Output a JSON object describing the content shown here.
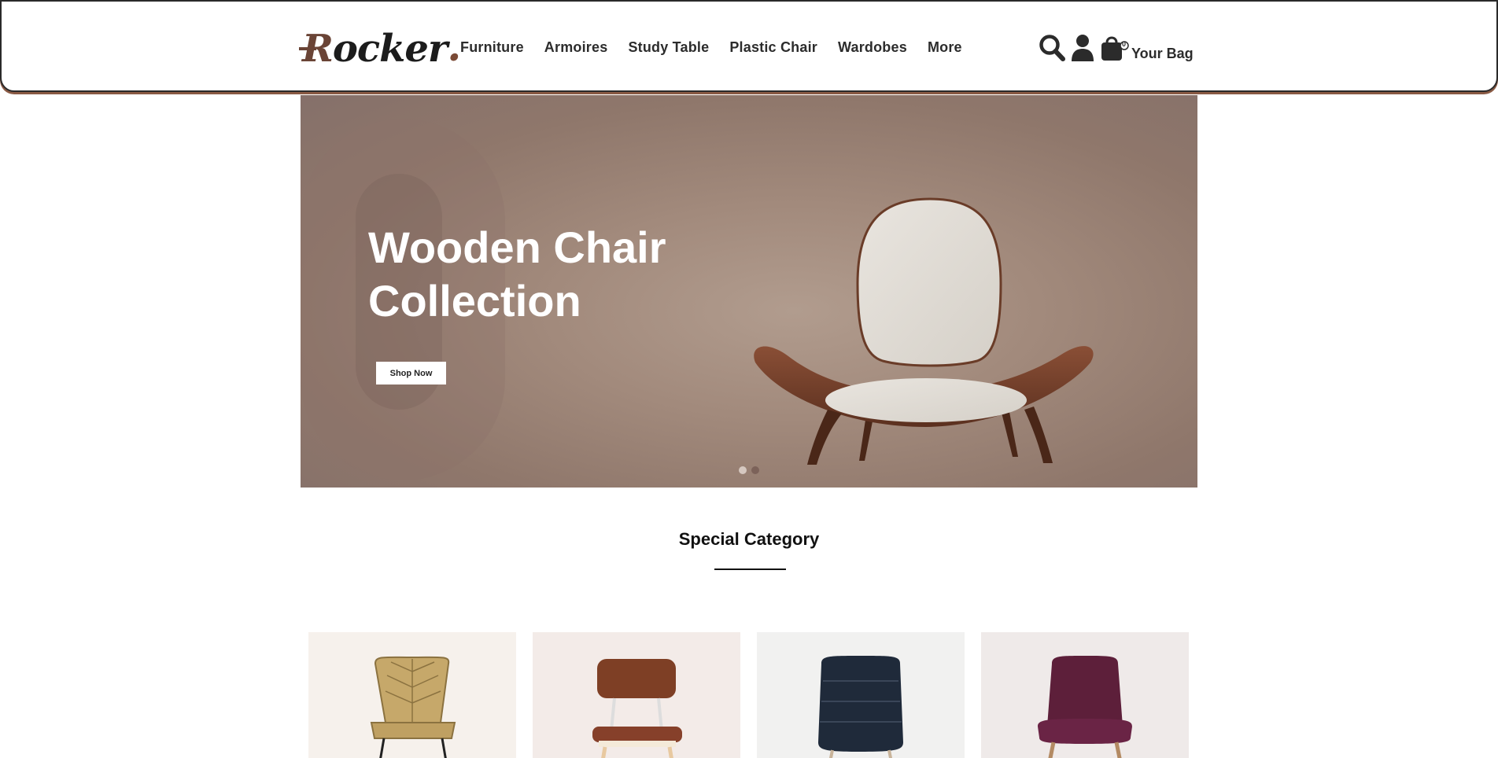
{
  "header": {
    "logo": {
      "first": "R",
      "rest": "ocker",
      "dot": "."
    },
    "nav": [
      "Furniture",
      "Armoires",
      "Study Table",
      "Plastic Chair",
      "Wardobes",
      "More"
    ],
    "bag_label": "Your Bag",
    "bag_count": "0",
    "icons": [
      "search-icon",
      "user-icon",
      "shopping-bag-icon"
    ]
  },
  "hero": {
    "title_line1": "Wooden Chair",
    "title_line2": "Collection",
    "cta": "Shop Now",
    "slides": 2,
    "active_slide": 2
  },
  "special": {
    "title": "Special Category",
    "cards": [
      {
        "name": "rattan-chair",
        "bg": "#f6f1ec"
      },
      {
        "name": "brown-leather-chair",
        "bg": "#f3ebe8"
      },
      {
        "name": "navy-tufted-chair",
        "bg": "#f1f1f0"
      },
      {
        "name": "plum-upholstered-chair",
        "bg": "#efeae9"
      }
    ]
  },
  "colors": {
    "accent": "#7b4a36",
    "text": "#2c2c2c",
    "hero_bg": "#a28a7c"
  }
}
